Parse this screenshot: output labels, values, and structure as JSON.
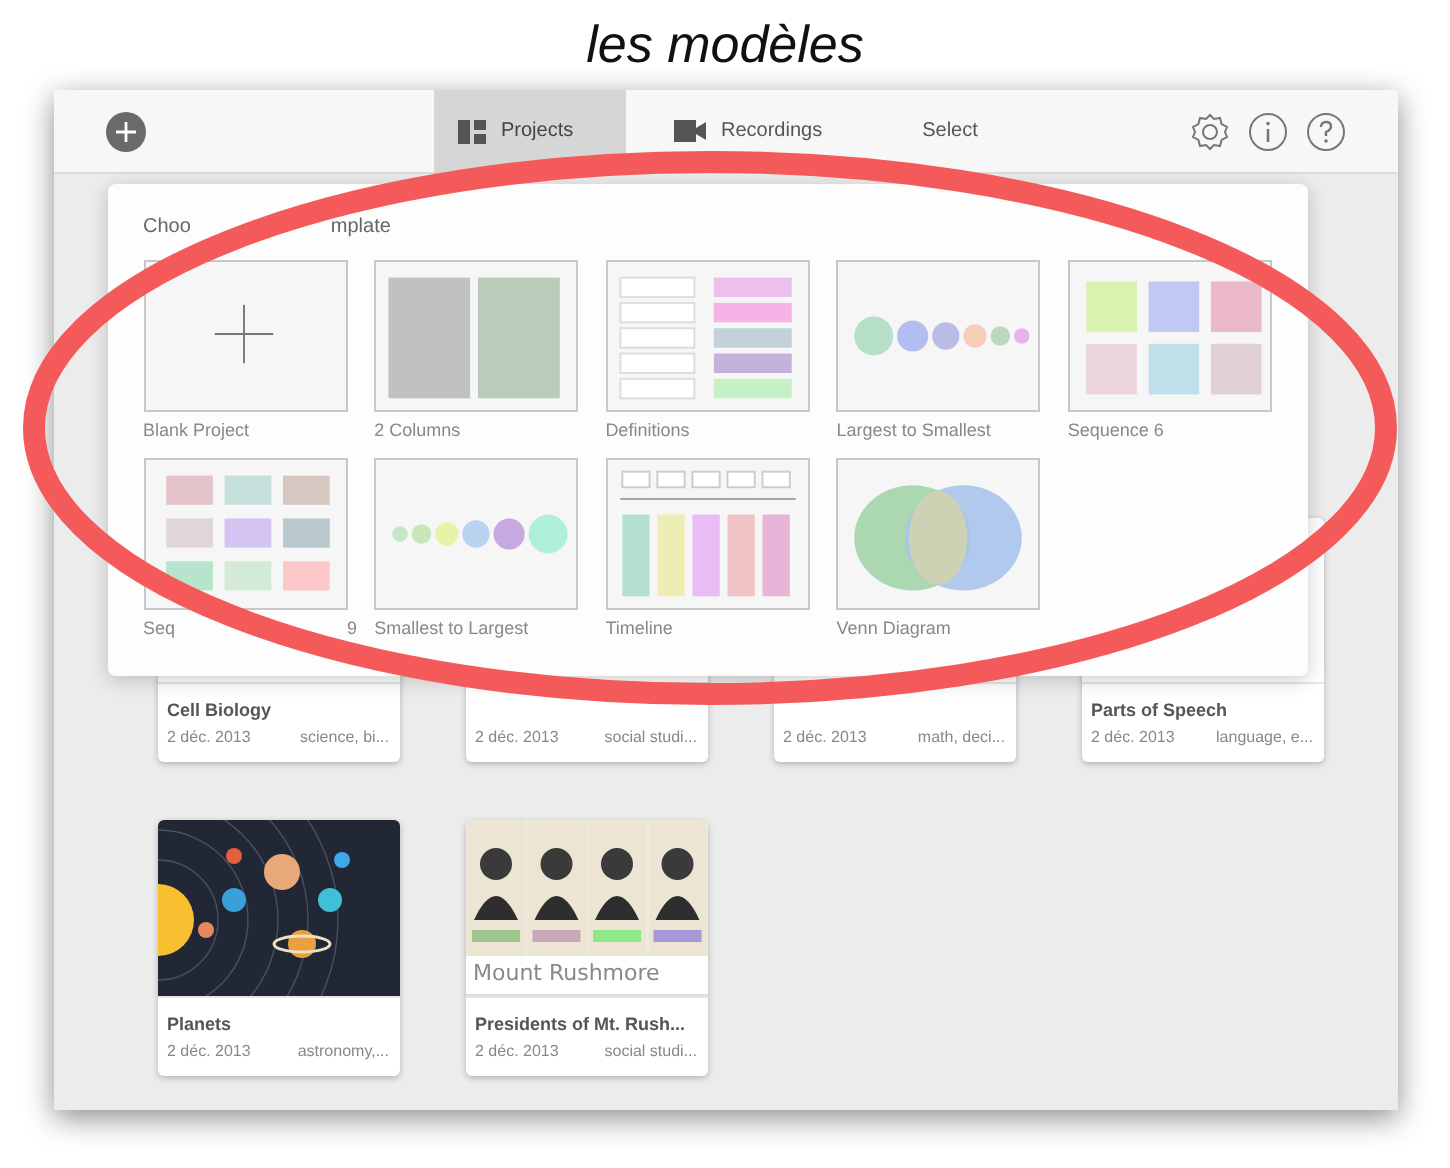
{
  "caption": "les modèles",
  "toolbar": {
    "tabs": [
      {
        "label": "Projects",
        "kind": "projects",
        "selected": true
      },
      {
        "label": "Recordings",
        "kind": "recordings",
        "selected": false
      }
    ],
    "select_label": "Select"
  },
  "template_picker": {
    "title": "Choo",
    "title_end": "mplate",
    "templates": [
      {
        "label": "Blank Project",
        "kind": "blank"
      },
      {
        "label": "2 Columns",
        "kind": "columns"
      },
      {
        "label": "Definitions",
        "kind": "definitions"
      },
      {
        "label": "Largest to Smallest",
        "kind": "largest"
      },
      {
        "label": "Sequence 6",
        "kind": "sequence6"
      },
      {
        "label": "Seq",
        "label_end": "9",
        "kind": "sequence9"
      },
      {
        "label": "Smallest to Largest",
        "kind": "smallest"
      },
      {
        "label": "Timeline",
        "kind": "timeline"
      },
      {
        "label": "Venn Diagram",
        "kind": "venn"
      }
    ]
  },
  "projects": [
    {
      "title": "Cell Biology",
      "date": "2 déc. 2013",
      "tags": "science, bi..."
    },
    {
      "date": "2 déc. 2013",
      "tags": "social studi..."
    },
    {
      "date": "2 déc. 2013",
      "tags": "math, deci..."
    },
    {
      "title": "Parts of Speech",
      "date": "2 déc. 2013",
      "tags": "language, e..."
    },
    {
      "title": "Planets",
      "date": "2 déc. 2013",
      "tags": "astronomy,...",
      "kind": "planets"
    },
    {
      "title": "Presidents of Mt. Rush...",
      "date": "2 déc. 2013",
      "tags": "social studi...",
      "kind": "presidents",
      "thumb_caption": "Mount Rushmore"
    }
  ]
}
